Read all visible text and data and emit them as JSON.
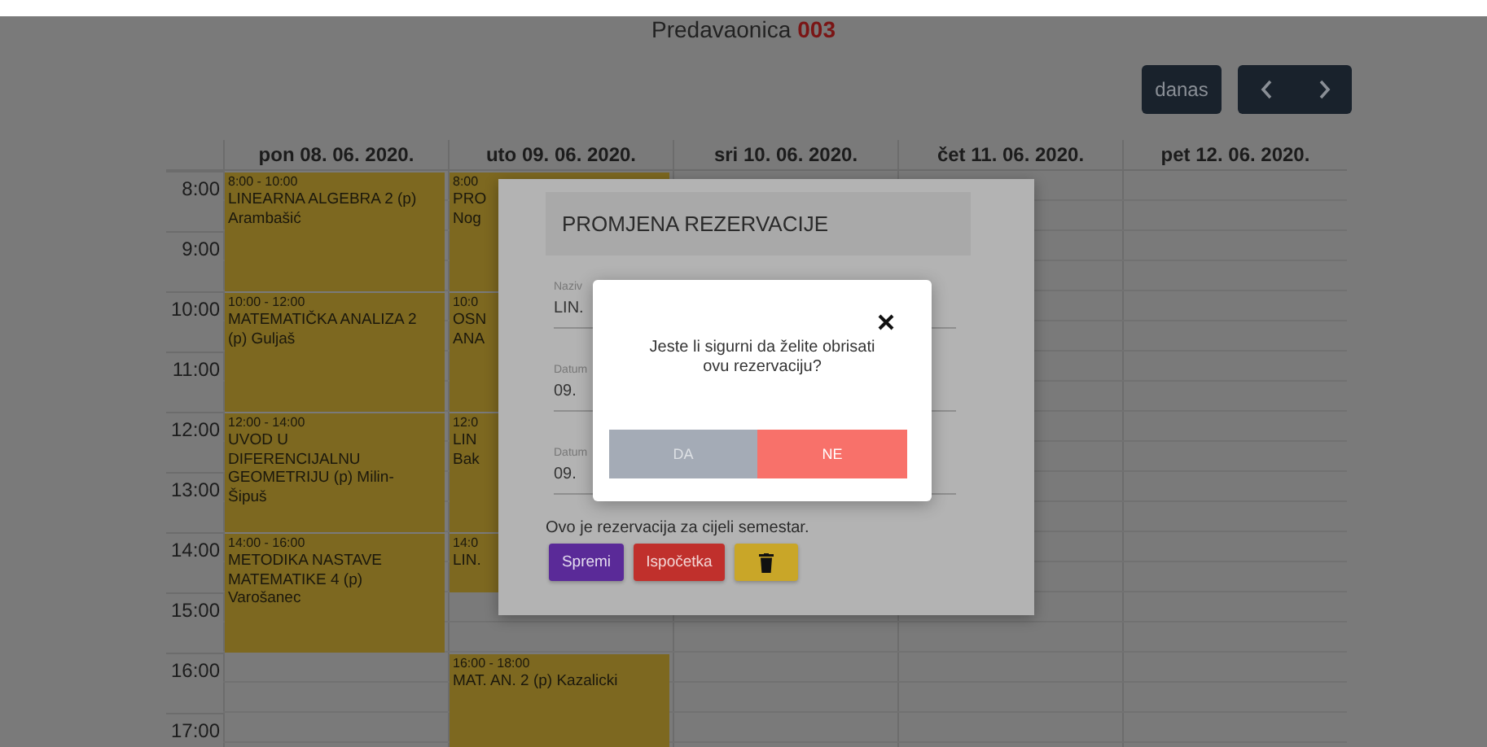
{
  "header": {
    "title": "Predavaonica",
    "room": "003"
  },
  "toolbar": {
    "today": "danas"
  },
  "calendar": {
    "times": [
      "8:00",
      "9:00",
      "10:00",
      "11:00",
      "12:00",
      "13:00",
      "14:00",
      "15:00",
      "16:00",
      "17:00"
    ],
    "days": [
      {
        "label": "pon 08. 06. 2020.",
        "slots": [
          {
            "kind": "event",
            "time": "8:00 - 10:00",
            "lines": [
              "LINEARNA ALGEBRA 2 (p)",
              "Arambašić"
            ]
          },
          {
            "kind": "more"
          },
          {
            "kind": "event",
            "time": "10:00 - 12:00",
            "lines": [
              "MATEMATIČKA ANALIZA 2",
              "(p) Guljaš"
            ]
          },
          {
            "kind": "more"
          },
          {
            "kind": "event",
            "time": "12:00 - 14:00",
            "lines": [
              "UVOD U",
              "DIFERENCIJALNU",
              "GEOMETRIJU (p) Milin-",
              "Šipuš"
            ]
          },
          {
            "kind": "more"
          },
          {
            "kind": "event",
            "time": "14:00 - 16:00",
            "lines": [
              "METODIKA NASTAVE",
              "MATEMATIKE 4 (p)",
              "Varošanec"
            ]
          },
          {
            "kind": "more"
          },
          {
            "kind": "free"
          },
          {
            "kind": "free"
          }
        ]
      },
      {
        "label": "uto 09. 06. 2020.",
        "slots": [
          {
            "kind": "event",
            "time": "8:00",
            "lines": [
              "PRO",
              "Nog"
            ]
          },
          {
            "kind": "more"
          },
          {
            "kind": "event",
            "time": "10:0",
            "lines": [
              "OSN",
              "ANA"
            ]
          },
          {
            "kind": "more"
          },
          {
            "kind": "event",
            "time": "12:0",
            "lines": [
              "LIN",
              "Bak"
            ]
          },
          {
            "kind": "more"
          },
          {
            "kind": "event",
            "time": "14:0",
            "lines": [
              "LIN."
            ]
          },
          {
            "kind": "free"
          },
          {
            "kind": "event",
            "time": "16:00 - 18:00",
            "lines": [
              "MAT. AN. 2 (p) Kazalicki"
            ]
          },
          {
            "kind": "more"
          }
        ]
      },
      {
        "label": "sri 10. 06. 2020."
      },
      {
        "label": "čet 11. 06. 2020."
      },
      {
        "label": "pet 12. 06. 2020."
      }
    ]
  },
  "edit_dialog": {
    "title": "PROMJENA REZERVACIJE",
    "fields": [
      {
        "label": "Naziv",
        "value": "LIN."
      },
      {
        "label": "Datum",
        "value": "09."
      },
      {
        "label": "Datum",
        "value": "09."
      }
    ],
    "note": "Ovo je rezervacija za cijeli semestar.",
    "buttons": [
      {
        "kind": "save",
        "label": "Spremi"
      },
      {
        "kind": "reset",
        "label": "Ispočetka"
      },
      {
        "kind": "delete"
      }
    ]
  },
  "confirm_dialog": {
    "message": "Jeste li sigurni da želite obrisati ovu rezervaciju?",
    "buttons": [
      {
        "kind": "confirm",
        "label": "DA"
      },
      {
        "kind": "cancel",
        "label": "NE"
      }
    ]
  }
}
